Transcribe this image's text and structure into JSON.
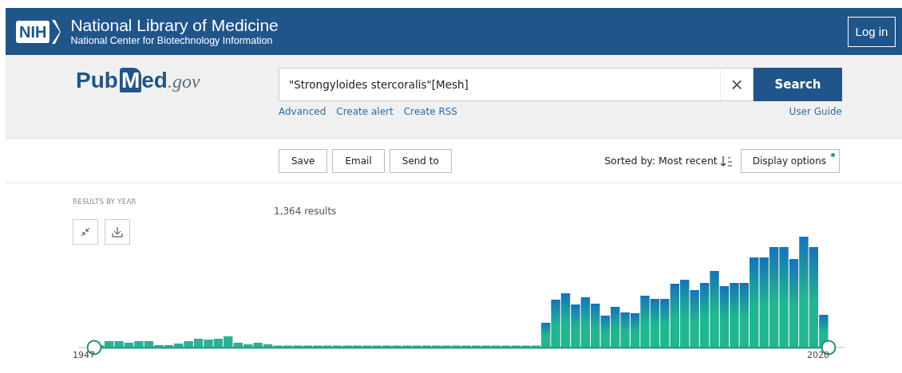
{
  "header": {
    "badge": "NIH",
    "title": "National Library of Medicine",
    "subtitle": "National Center for Biotechnology Information",
    "login": "Log in"
  },
  "search": {
    "logo": {
      "before": "Pub",
      "mark": "M",
      "after": "ed",
      "suffix": ".gov"
    },
    "query": "\"Strongyloides stercoralis\"[Mesh]",
    "clear": "×",
    "button": "Search",
    "links": [
      "Advanced",
      "Create alert",
      "Create RSS"
    ],
    "guide": "User Guide"
  },
  "toolbar": {
    "actions": [
      "Save",
      "Email",
      "Send to"
    ],
    "sort": "Sorted by: Most recent",
    "display": {
      "label": "Display options",
      "changed": true
    }
  },
  "timeline": {
    "heading": "RESULTS BY YEAR",
    "count": "1,364 results",
    "start": "1947",
    "end": "2020"
  }
}
